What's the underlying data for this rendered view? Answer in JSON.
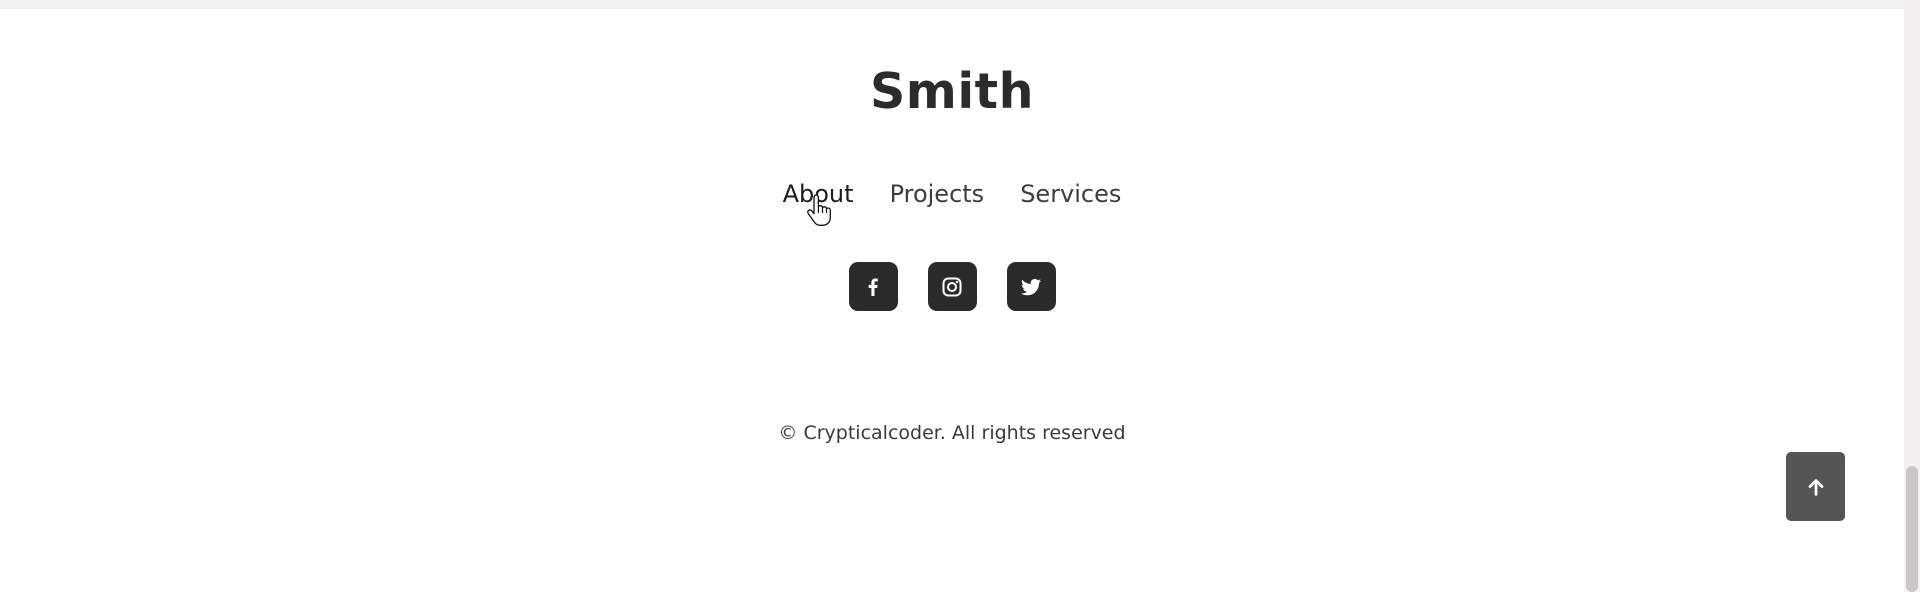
{
  "footer": {
    "brand": "Smith",
    "nav": [
      {
        "label": "About",
        "active": true
      },
      {
        "label": "Projects",
        "active": false
      },
      {
        "label": "Services",
        "active": false
      }
    ],
    "socials": [
      {
        "icon": "facebook-icon"
      },
      {
        "icon": "instagram-icon"
      },
      {
        "icon": "twitter-icon"
      }
    ],
    "copyright": "© Crypticalcoder. All rights reserved"
  },
  "back_to_top": {
    "icon": "arrow-up-icon"
  },
  "colors": {
    "brand_text": "#2c2c2c",
    "social_bg": "#2b2b2b",
    "back_to_top_bg": "#555555"
  }
}
